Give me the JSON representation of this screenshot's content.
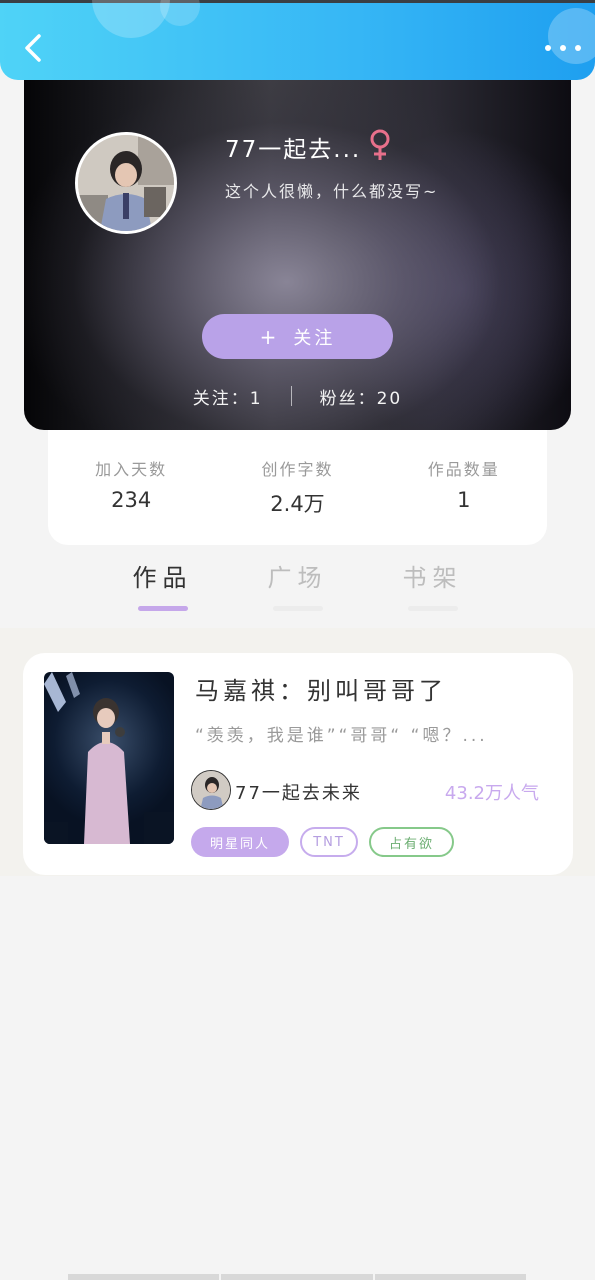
{
  "header": {
    "back_icon": "chevron-left-icon",
    "more_icon": "more-horizontal-icon"
  },
  "profile": {
    "username": "77一起去...",
    "gender_icon": "female-icon",
    "gender_color": "#e8708b",
    "bio": "这个人很懒，什么都没写~",
    "follow_button": "关注",
    "follow_plus": "+",
    "following_label": "关注：",
    "following_count": "1",
    "fans_label": "粉丝：",
    "fans_count": "20"
  },
  "stats": [
    {
      "label": "加入天数",
      "value": "234"
    },
    {
      "label": "创作字数",
      "value": "2.4万"
    },
    {
      "label": "作品数量",
      "value": "1"
    }
  ],
  "tabs": [
    {
      "label": "作品",
      "active": true
    },
    {
      "label": "广场",
      "active": false
    },
    {
      "label": "书架",
      "active": false
    }
  ],
  "works": [
    {
      "title": "马嘉祺：别叫哥哥了",
      "excerpt": "“羡羡，我是谁”“哥哥“ “嗯？...",
      "author": "77一起去未来",
      "popularity": "43.2万人气",
      "tags": [
        "明星同人",
        "TNT",
        "占有欲"
      ]
    }
  ],
  "colors": {
    "header_blue": "#36b6f5",
    "accent_purple": "#b9a2e8",
    "tag_green": "#86c98a"
  }
}
